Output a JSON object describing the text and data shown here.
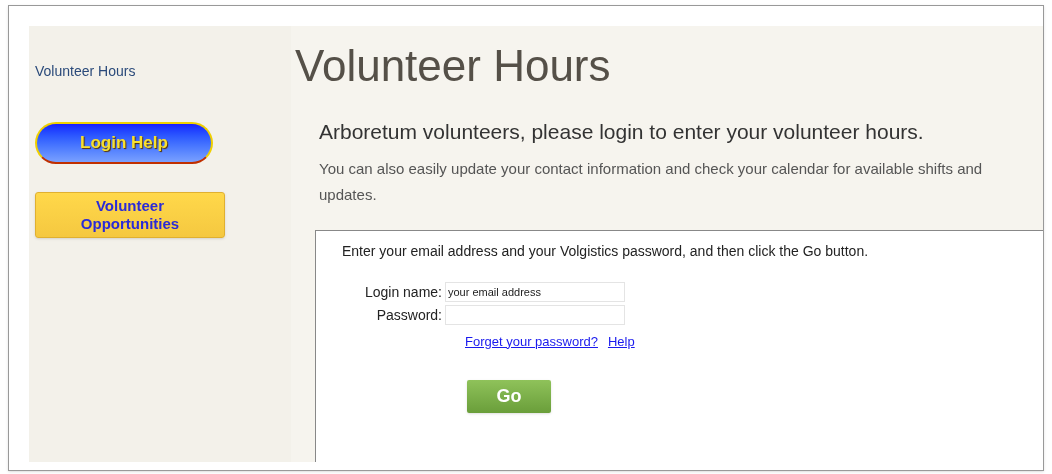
{
  "sidebar": {
    "link": "Volunteer Hours",
    "buttons": [
      {
        "label": "Login Help",
        "kind": "pill"
      },
      {
        "label": "Volunteer Opportunities",
        "kind": "box"
      }
    ]
  },
  "title": "Volunteer Hours",
  "heading": "Arboretum volunteers, please login to enter your volunteer hours.",
  "intro": "You can also easily update your contact information and check your calendar for available shifts and updates.",
  "login": {
    "instructions": "Enter your email address and your Volgistics password, and then click the Go button.",
    "fields": [
      {
        "label": "Login name:",
        "value": "your email address"
      },
      {
        "label": "Password:"
      }
    ],
    "links": [
      "Forget your password?",
      "Help"
    ],
    "submit": "Go"
  }
}
